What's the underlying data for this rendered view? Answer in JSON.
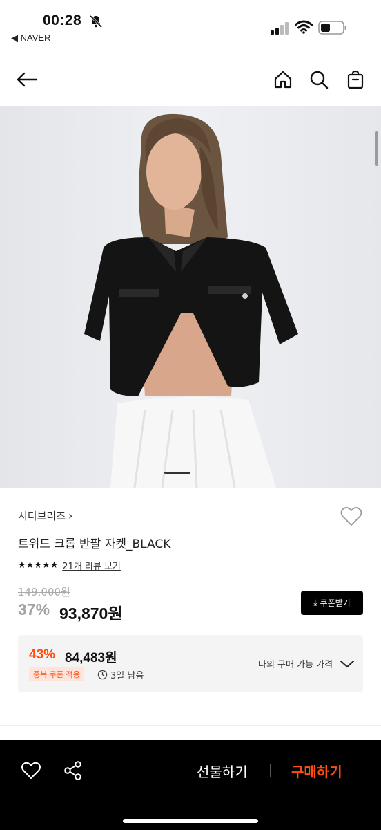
{
  "status_bar": {
    "time": "00:28",
    "back_app": "◀ NAVER"
  },
  "header": {
    "back_icon": "arrow-left-icon",
    "home_icon": "home-icon",
    "search_icon": "search-icon",
    "bag_icon": "shopping-bag-icon"
  },
  "product": {
    "brand": "시티브리즈",
    "name": "트위드 크롭 반팔 자켓_BLACK",
    "stars": "★★★★★",
    "review_link": "21개 리뷰 보기",
    "original_price": "149,000원",
    "discount": "37%",
    "sale_price": "93,870원",
    "coupon_button": "쿠폰받기"
  },
  "best_price": {
    "discount": "43%",
    "price": "84,483원",
    "badge": "중복 쿠폰 적용",
    "remaining": "3일 남음",
    "my_price_label": "나의 구매 가능 가격"
  },
  "bottom_bar": {
    "gift": "선물하기",
    "buy": "구매하기"
  },
  "colors": {
    "accent": "#ff4d12",
    "black": "#000000",
    "card_bg": "#f4f4f4"
  }
}
